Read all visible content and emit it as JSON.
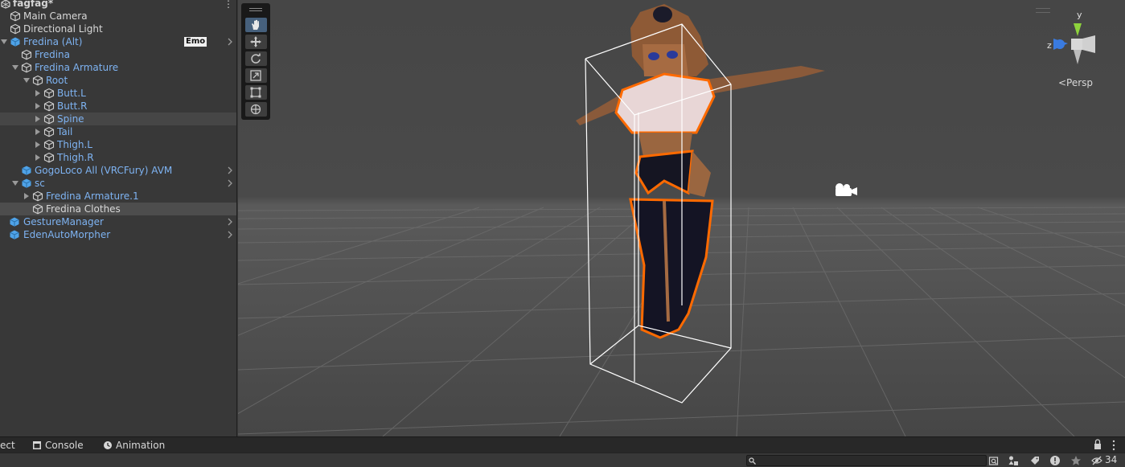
{
  "hierarchy": {
    "scene_name": "fagfag*",
    "badge": "Emo",
    "items": [
      {
        "label": "Main Camera"
      },
      {
        "label": "Directional Light"
      },
      {
        "label": "Fredina (Alt)"
      },
      {
        "label": "Fredina"
      },
      {
        "label": "Fredina Armature"
      },
      {
        "label": "Root"
      },
      {
        "label": "Butt.L"
      },
      {
        "label": "Butt.R"
      },
      {
        "label": "Spine"
      },
      {
        "label": "Tail"
      },
      {
        "label": "Thigh.L"
      },
      {
        "label": "Thigh.R"
      },
      {
        "label": "GogoLoco All (VRCFury) AVM"
      },
      {
        "label": "sc"
      },
      {
        "label": "Fredina Armature.1"
      },
      {
        "label": "Fredina Clothes"
      },
      {
        "label": "GestureManager"
      },
      {
        "label": "EdenAutoMorpher"
      }
    ]
  },
  "scene_view": {
    "projection_label": "<Persp",
    "gizmo_axes": {
      "y": "y",
      "z": "z"
    },
    "tools": [
      "hand-tool",
      "move-tool",
      "rotate-tool",
      "scale-tool",
      "rect-tool",
      "transform-tool"
    ],
    "active_tool": "hand-tool"
  },
  "bottom_tabs": {
    "project_partial": "ect",
    "console": "Console",
    "animation": "Animation"
  },
  "toolbar": {
    "search_value": "",
    "hidden_count": "34"
  },
  "colors": {
    "accent_blue": "#7eb3f2",
    "selection_outline": "#ff6a00",
    "active_tool": "#46607c"
  }
}
